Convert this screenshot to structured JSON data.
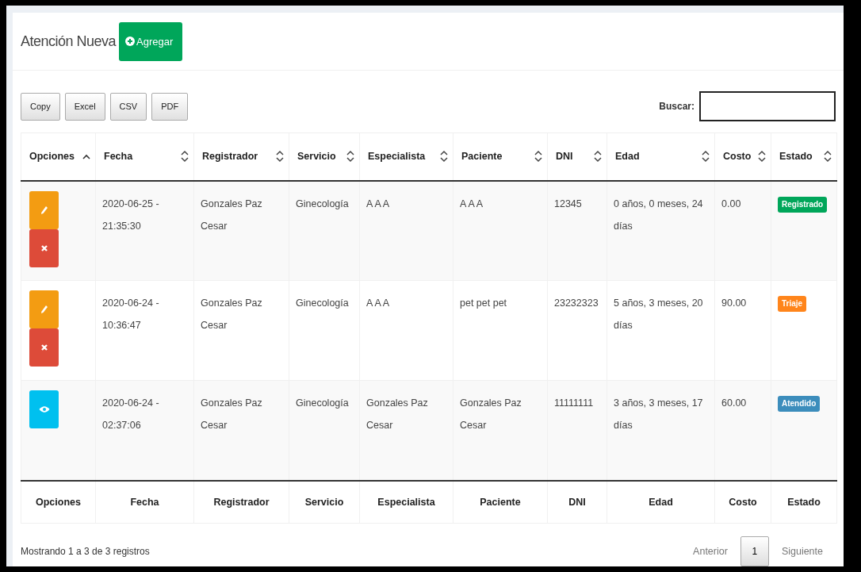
{
  "header": {
    "title": "Atención Nueva",
    "add_button": "Agregar"
  },
  "export_buttons": [
    "Copy",
    "Excel",
    "CSV",
    "PDF"
  ],
  "search": {
    "label": "Buscar:"
  },
  "table": {
    "columns": [
      {
        "label": "Opciones",
        "sorted": true
      },
      {
        "label": "Fecha",
        "sorted": false
      },
      {
        "label": "Registrador",
        "sorted": false
      },
      {
        "label": "Servicio",
        "sorted": false
      },
      {
        "label": "Especialista",
        "sorted": false
      },
      {
        "label": "Paciente",
        "sorted": false
      },
      {
        "label": "DNI",
        "sorted": false
      },
      {
        "label": "Edad",
        "sorted": false
      },
      {
        "label": "Costo",
        "sorted": false
      },
      {
        "label": "Estado",
        "sorted": false
      }
    ],
    "rows": [
      {
        "cells": [
          {
            "actions": [
              {
                "kind": "edit"
              },
              {
                "kind": "delete"
              }
            ]
          },
          "2020-06-25 - 21:35:30",
          "Gonzales Paz Cesar",
          "Ginecología",
          "A A A",
          "A A A",
          "12345",
          "0 años, 0 meses, 24 días",
          "0.00",
          {
            "label": "Registrado",
            "color": "#00a65a"
          }
        ]
      },
      {
        "cells": [
          {
            "actions": [
              {
                "kind": "edit"
              },
              {
                "kind": "delete"
              }
            ]
          },
          "2020-06-24 - 10:36:47",
          "Gonzales Paz Cesar",
          "Ginecología",
          "A A A",
          "pet pet pet",
          "23232323",
          "5 años, 3 meses, 20 días",
          "90.00",
          {
            "label": "Triaje",
            "color": "#ff851b"
          }
        ]
      },
      {
        "cells": [
          {
            "actions": [
              {
                "kind": "view"
              }
            ]
          },
          "2020-06-24 - 02:37:06",
          "Gonzales Paz Cesar",
          "Ginecología",
          "Gonzales Paz Cesar",
          "Gonzales Paz Cesar",
          "11111111",
          "3 años, 3 meses, 17 días",
          "60.00",
          {
            "label": "Atendido",
            "color": "#3c8dbc"
          }
        ]
      }
    ],
    "footer_columns": [
      "Opciones",
      "Fecha",
      "Registrador",
      "Servicio",
      "Especialista",
      "Paciente",
      "DNI",
      "Edad",
      "Costo",
      "Estado"
    ]
  },
  "info": "Mostrando 1 a 3 de 3 registros",
  "pagination": {
    "previous": "Anterior",
    "pages": [
      {
        "label": "1",
        "selected": true
      }
    ],
    "next": "Siguiente"
  }
}
